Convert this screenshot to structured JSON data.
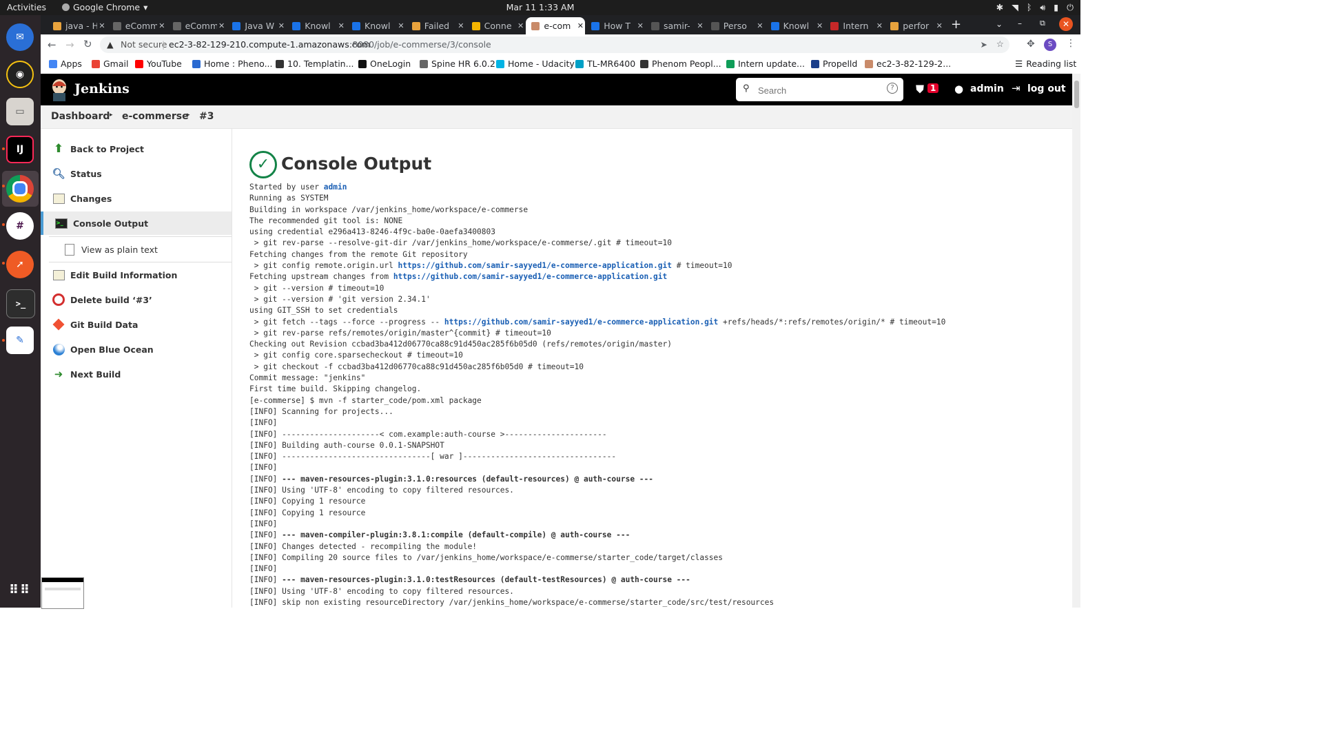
{
  "os": {
    "activities": "Activities",
    "app_name": "Google Chrome",
    "clock": "Mar 11  1:33 AM"
  },
  "tabs": [
    {
      "label": "java - H",
      "color": "#e8a33d"
    },
    {
      "label": "eComm",
      "color": "#666"
    },
    {
      "label": "eComm",
      "color": "#666"
    },
    {
      "label": "Java W",
      "color": "#1a73e8"
    },
    {
      "label": "Knowl",
      "color": "#1a73e8"
    },
    {
      "label": "Knowl",
      "color": "#1a73e8"
    },
    {
      "label": "Failed",
      "color": "#e8a33d"
    },
    {
      "label": "Conne",
      "color": "#f4b400"
    },
    {
      "label": "e-com",
      "color": "#c98b6a"
    },
    {
      "label": "How T",
      "color": "#1a73e8"
    },
    {
      "label": "samir-",
      "color": "#555"
    },
    {
      "label": "Perso",
      "color": "#555"
    },
    {
      "label": "Knowl",
      "color": "#1a73e8"
    },
    {
      "label": "Intern",
      "color": "#c62828"
    },
    {
      "label": "perfor",
      "color": "#e8a33d"
    }
  ],
  "address": {
    "security": "Not secure",
    "url_main": "ec2-3-82-129-210.compute-1.amazonaws.com",
    "url_rest": ":8080/job/e-commerse/3/console"
  },
  "profile_initial": "S",
  "bookmarks": [
    {
      "label": "Apps",
      "color": "#4285f4"
    },
    {
      "label": "Gmail",
      "color": "#ea4335"
    },
    {
      "label": "YouTube",
      "color": "#ff0000"
    },
    {
      "label": "Home : Pheno...",
      "color": "#2a6ad1"
    },
    {
      "label": "10. Templatin...",
      "color": "#333"
    },
    {
      "label": "OneLogin",
      "color": "#111"
    },
    {
      "label": "Spine HR 6.0.2",
      "color": "#666"
    },
    {
      "label": "Home - Udacity",
      "color": "#02b3e4"
    },
    {
      "label": "TL-MR6400",
      "color": "#00a0c6"
    },
    {
      "label": "Phenom Peopl...",
      "color": "#333"
    },
    {
      "label": "Intern update...",
      "color": "#0f9d58"
    },
    {
      "label": "Propelld",
      "color": "#1a3e8a"
    },
    {
      "label": "ec2-3-82-129-2...",
      "color": "#c98b6a"
    }
  ],
  "reading_list": "Reading list",
  "jenkins": {
    "brand": "Jenkins",
    "search_placeholder": "Search",
    "alert_count": "1",
    "user": "admin",
    "logout": "log out"
  },
  "breadcrumb": [
    "Dashboard",
    "e-commerse",
    "#3"
  ],
  "sidebar": [
    {
      "label": "Back to Project",
      "icon": "up-arrow-icon"
    },
    {
      "label": "Status",
      "icon": "magnifier-icon"
    },
    {
      "label": "Changes",
      "icon": "notepad-icon"
    },
    {
      "label": "Console Output",
      "icon": "terminal-icon"
    },
    {
      "label": "View as plain text",
      "icon": "document-icon"
    },
    {
      "label": "Edit Build Information",
      "icon": "notepad-icon"
    },
    {
      "label": "Delete build ‘#3’",
      "icon": "no-entry-icon"
    },
    {
      "label": "Git Build Data",
      "icon": "git-icon"
    },
    {
      "label": "Open Blue Ocean",
      "icon": "blue-ocean-icon"
    },
    {
      "label": "Next Build",
      "icon": "right-arrow-icon"
    }
  ],
  "page_title": "Console Output",
  "console": [
    {
      "t": "Started by user ",
      "link": "admin"
    },
    {
      "t": "Running as SYSTEM"
    },
    {
      "t": "Building in workspace /var/jenkins_home/workspace/e-commerse"
    },
    {
      "t": "The recommended git tool is: NONE"
    },
    {
      "t": "using credential e296a413-8246-4f9c-ba0e-0aefa3400803"
    },
    {
      "t": " > git rev-parse --resolve-git-dir /var/jenkins_home/workspace/e-commerse/.git # timeout=10"
    },
    {
      "t": "Fetching changes from the remote Git repository"
    },
    {
      "t": " > git config remote.origin.url ",
      "link": "https://github.com/samir-sayyed1/e-commerce-application.git",
      "t2": " # timeout=10"
    },
    {
      "t": "Fetching upstream changes from ",
      "link": "https://github.com/samir-sayyed1/e-commerce-application.git"
    },
    {
      "t": " > git --version # timeout=10"
    },
    {
      "t": " > git --version # 'git version 2.34.1'"
    },
    {
      "t": "using GIT_SSH to set credentials"
    },
    {
      "t": " > git fetch --tags --force --progress -- ",
      "link": "https://github.com/samir-sayyed1/e-commerce-application.git",
      "t2": " +refs/heads/*:refs/remotes/origin/* # timeout=10"
    },
    {
      "t": " > git rev-parse refs/remotes/origin/master^{commit} # timeout=10"
    },
    {
      "t": "Checking out Revision ccbad3ba412d06770ca88c91d450ac285f6b05d0 (refs/remotes/origin/master)"
    },
    {
      "t": " > git config core.sparsecheckout # timeout=10"
    },
    {
      "t": " > git checkout -f ccbad3ba412d06770ca88c91d450ac285f6b05d0 # timeout=10"
    },
    {
      "t": "Commit message: \"jenkins\""
    },
    {
      "t": "First time build. Skipping changelog."
    },
    {
      "t": "[e-commerse] $ mvn -f starter_code/pom.xml package"
    },
    {
      "t": "[INFO] Scanning for projects..."
    },
    {
      "t": "[INFO]"
    },
    {
      "t": "[INFO] ---------------------< com.example:auth-course >----------------------"
    },
    {
      "t": "[INFO] Building auth-course 0.0.1-SNAPSHOT"
    },
    {
      "t": "[INFO] --------------------------------[ war ]---------------------------------"
    },
    {
      "t": "[INFO]"
    },
    {
      "t": "[INFO] ",
      "bold": "--- maven-resources-plugin:3.1.0:resources (default-resources) @ auth-course ---"
    },
    {
      "t": "[INFO] Using 'UTF-8' encoding to copy filtered resources."
    },
    {
      "t": "[INFO] Copying 1 resource"
    },
    {
      "t": "[INFO] Copying 1 resource"
    },
    {
      "t": "[INFO]"
    },
    {
      "t": "[INFO] ",
      "bold": "--- maven-compiler-plugin:3.8.1:compile (default-compile) @ auth-course ---"
    },
    {
      "t": "[INFO] Changes detected - recompiling the module!"
    },
    {
      "t": "[INFO] Compiling 20 source files to /var/jenkins_home/workspace/e-commerse/starter_code/target/classes"
    },
    {
      "t": "[INFO]"
    },
    {
      "t": "[INFO] ",
      "bold": "--- maven-resources-plugin:3.1.0:testResources (default-testResources) @ auth-course ---"
    },
    {
      "t": "[INFO] Using 'UTF-8' encoding to copy filtered resources."
    },
    {
      "t": "[INFO] skip non existing resourceDirectory /var/jenkins_home/workspace/e-commerse/starter_code/src/test/resources"
    }
  ]
}
